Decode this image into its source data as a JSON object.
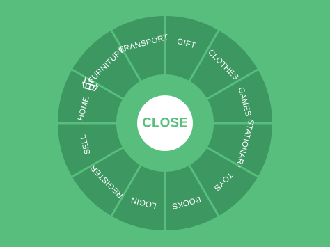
{
  "colors": {
    "background": "#58be7d",
    "segment": "#3d9761",
    "segment_gap": "#58be7d",
    "close_fill": "#ffffff",
    "close_text": "#58be7d",
    "label": "#ffffff"
  },
  "menu": {
    "items": [
      {
        "label": "GIFT",
        "name": "menu-item-gift"
      },
      {
        "label": "CLOTHES",
        "name": "menu-item-clothes"
      },
      {
        "label": "GAMES",
        "name": "menu-item-games"
      },
      {
        "label": "STATIONARY",
        "name": "menu-item-stationary"
      },
      {
        "label": "TOYS",
        "name": "menu-item-toys"
      },
      {
        "label": "BOOKS",
        "name": "menu-item-books"
      },
      {
        "label": "LOGIN",
        "name": "menu-item-login"
      },
      {
        "label": "REGISTER",
        "name": "menu-item-register"
      },
      {
        "label": "SELL",
        "name": "menu-item-sell"
      },
      {
        "label": "HOME",
        "name": "menu-item-home",
        "icon": "shop-icon"
      },
      {
        "label": "FURNITURE",
        "name": "menu-item-furniture"
      },
      {
        "label": "TRANSPORT",
        "name": "menu-item-transport"
      }
    ]
  },
  "close_button": {
    "label": "CLOSE"
  }
}
